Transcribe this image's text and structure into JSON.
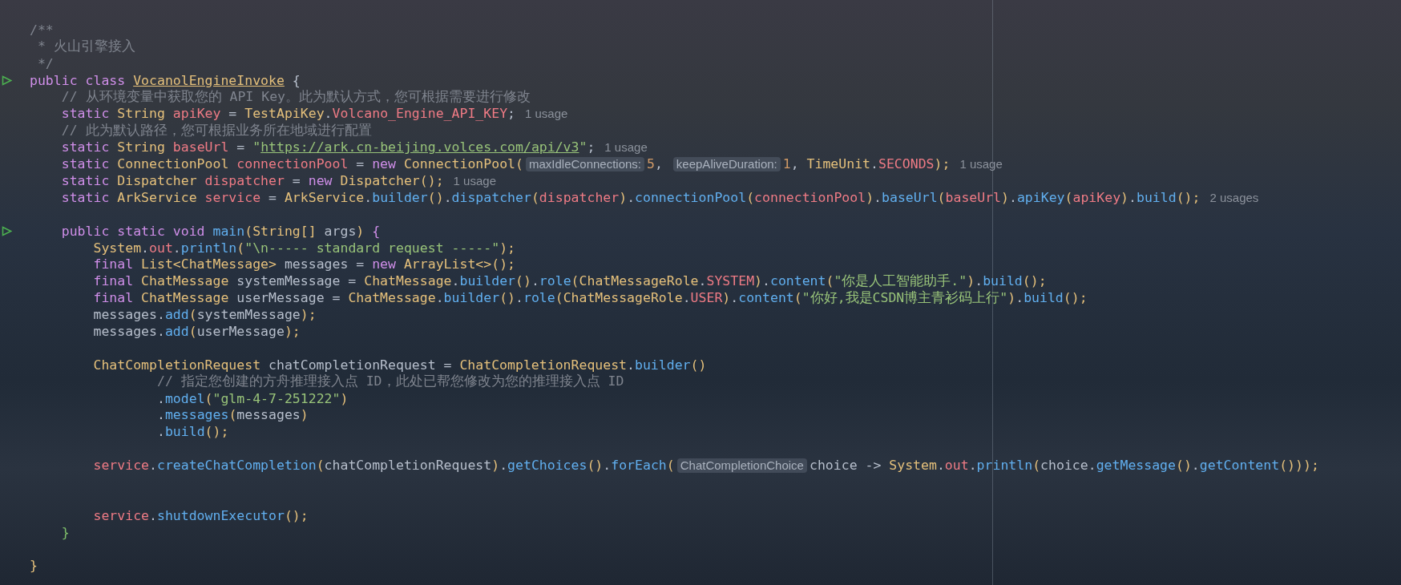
{
  "editor": {
    "lines": [
      {
        "run_marker": false,
        "runs": [
          {
            "kind": "code",
            "tokens": [
              {
                "kind": "comment",
                "text": "/**"
              }
            ]
          }
        ]
      },
      {
        "run_marker": false,
        "runs": [
          {
            "kind": "code",
            "tokens": [
              {
                "kind": "comment",
                "text": " * 火山引擎接入"
              }
            ]
          }
        ]
      },
      {
        "run_marker": false,
        "runs": [
          {
            "kind": "code",
            "tokens": [
              {
                "kind": "comment",
                "text": " */"
              }
            ]
          }
        ]
      },
      {
        "run_marker": true,
        "runs": [
          {
            "kind": "code",
            "tokens": [
              {
                "kind": "keyword",
                "text": "public class "
              },
              {
                "kind": "classname",
                "text": "VocanolEngineInvoke"
              },
              {
                "kind": "plain",
                "text": " {"
              }
            ]
          }
        ]
      },
      {
        "run_marker": false,
        "runs": [
          {
            "kind": "code",
            "tokens": [
              {
                "kind": "comment",
                "text": "    // 从环境变量中获取您的 API Key。此为默认方式，您可根据需要进行修改"
              }
            ]
          }
        ]
      },
      {
        "run_marker": false,
        "runs": [
          {
            "kind": "code",
            "tokens": [
              {
                "kind": "keyword",
                "text": "    static "
              },
              {
                "kind": "type",
                "text": "String "
              },
              {
                "kind": "field",
                "text": "apiKey"
              },
              {
                "kind": "plain",
                "text": " = "
              },
              {
                "kind": "type",
                "text": "TestApiKey"
              },
              {
                "kind": "plain",
                "text": "."
              },
              {
                "kind": "field",
                "text": "Volcano_Engine_API_KEY"
              },
              {
                "kind": "plain",
                "text": ";"
              }
            ]
          },
          {
            "kind": "usage",
            "text": "1 usage"
          }
        ]
      },
      {
        "run_marker": false,
        "runs": [
          {
            "kind": "code",
            "tokens": [
              {
                "kind": "comment",
                "text": "    // 此为默认路径，您可根据业务所在地域进行配置"
              }
            ]
          }
        ]
      },
      {
        "run_marker": false,
        "runs": [
          {
            "kind": "code",
            "tokens": [
              {
                "kind": "keyword",
                "text": "    static "
              },
              {
                "kind": "type",
                "text": "String "
              },
              {
                "kind": "field",
                "text": "baseUrl"
              },
              {
                "kind": "plain",
                "text": " = "
              },
              {
                "kind": "string",
                "text": "\""
              },
              {
                "kind": "link",
                "text": "https://ark.cn-beijing.volces.com/api/v3"
              },
              {
                "kind": "string",
                "text": "\""
              },
              {
                "kind": "plain",
                "text": ";"
              }
            ]
          },
          {
            "kind": "usage",
            "text": "1 usage"
          }
        ]
      },
      {
        "run_marker": false,
        "runs": [
          {
            "kind": "code",
            "tokens": [
              {
                "kind": "keyword",
                "text": "    static "
              },
              {
                "kind": "type",
                "text": "ConnectionPool "
              },
              {
                "kind": "field",
                "text": "connectionPool"
              },
              {
                "kind": "plain",
                "text": " = "
              },
              {
                "kind": "keyword",
                "text": "new "
              },
              {
                "kind": "type",
                "text": "ConnectionPool("
              }
            ]
          },
          {
            "kind": "hint",
            "text": "maxIdleConnections:"
          },
          {
            "kind": "code",
            "tokens": [
              {
                "kind": "number",
                "text": "5"
              },
              {
                "kind": "plain",
                "text": ", "
              }
            ]
          },
          {
            "kind": "hint",
            "text": "keepAliveDuration:"
          },
          {
            "kind": "code",
            "tokens": [
              {
                "kind": "number",
                "text": "1"
              },
              {
                "kind": "plain",
                "text": ", "
              },
              {
                "kind": "type",
                "text": "TimeUnit"
              },
              {
                "kind": "plain",
                "text": "."
              },
              {
                "kind": "field",
                "text": "SECONDS"
              },
              {
                "kind": "type",
                "text": ");"
              }
            ]
          },
          {
            "kind": "usage",
            "text": "1 usage"
          }
        ]
      },
      {
        "run_marker": false,
        "runs": [
          {
            "kind": "code",
            "tokens": [
              {
                "kind": "keyword",
                "text": "    static "
              },
              {
                "kind": "type",
                "text": "Dispatcher "
              },
              {
                "kind": "field",
                "text": "dispatcher"
              },
              {
                "kind": "plain",
                "text": " = "
              },
              {
                "kind": "keyword",
                "text": "new "
              },
              {
                "kind": "type",
                "text": "Dispatcher();"
              }
            ]
          },
          {
            "kind": "usage",
            "text": "1 usage"
          }
        ]
      },
      {
        "run_marker": false,
        "runs": [
          {
            "kind": "code",
            "tokens": [
              {
                "kind": "keyword",
                "text": "    static "
              },
              {
                "kind": "type",
                "text": "ArkService "
              },
              {
                "kind": "field",
                "text": "service"
              },
              {
                "kind": "plain",
                "text": " = "
              },
              {
                "kind": "type",
                "text": "ArkService"
              },
              {
                "kind": "plain",
                "text": "."
              },
              {
                "kind": "method",
                "text": "builder"
              },
              {
                "kind": "type",
                "text": "()"
              },
              {
                "kind": "plain",
                "text": "."
              },
              {
                "kind": "method",
                "text": "dispatcher"
              },
              {
                "kind": "type",
                "text": "("
              },
              {
                "kind": "field",
                "text": "dispatcher"
              },
              {
                "kind": "type",
                "text": ")"
              },
              {
                "kind": "plain",
                "text": "."
              },
              {
                "kind": "method",
                "text": "connectionPool"
              },
              {
                "kind": "type",
                "text": "("
              },
              {
                "kind": "field",
                "text": "connectionPool"
              },
              {
                "kind": "type",
                "text": ")"
              },
              {
                "kind": "plain",
                "text": "."
              },
              {
                "kind": "method",
                "text": "baseUrl"
              },
              {
                "kind": "type",
                "text": "("
              },
              {
                "kind": "field",
                "text": "baseUrl"
              },
              {
                "kind": "type",
                "text": ")"
              },
              {
                "kind": "plain",
                "text": "."
              },
              {
                "kind": "method",
                "text": "apiKey"
              },
              {
                "kind": "type",
                "text": "("
              },
              {
                "kind": "field",
                "text": "apiKey"
              },
              {
                "kind": "type",
                "text": ")"
              },
              {
                "kind": "plain",
                "text": "."
              },
              {
                "kind": "method",
                "text": "build"
              },
              {
                "kind": "type",
                "text": "();"
              }
            ]
          },
          {
            "kind": "usage",
            "text": "2 usages"
          }
        ]
      },
      {
        "run_marker": false
      },
      {
        "run_marker": true,
        "runs": [
          {
            "kind": "code",
            "tokens": [
              {
                "kind": "keyword",
                "text": "    public static void "
              },
              {
                "kind": "method",
                "text": "main"
              },
              {
                "kind": "type",
                "text": "(String[] "
              },
              {
                "kind": "plain",
                "text": "args"
              },
              {
                "kind": "type",
                "text": ") "
              },
              {
                "kind": "keyword",
                "text": "{"
              }
            ]
          }
        ]
      },
      {
        "run_marker": false,
        "runs": [
          {
            "kind": "code",
            "tokens": [
              {
                "kind": "type",
                "text": "        System"
              },
              {
                "kind": "plain",
                "text": "."
              },
              {
                "kind": "field",
                "text": "out"
              },
              {
                "kind": "plain",
                "text": "."
              },
              {
                "kind": "method",
                "text": "println"
              },
              {
                "kind": "type",
                "text": "("
              },
              {
                "kind": "string",
                "text": "\"\\n----- standard request -----\""
              },
              {
                "kind": "type",
                "text": ");"
              }
            ]
          }
        ]
      },
      {
        "run_marker": false,
        "runs": [
          {
            "kind": "code",
            "tokens": [
              {
                "kind": "keyword",
                "text": "        final "
              },
              {
                "kind": "type",
                "text": "List<ChatMessage> "
              },
              {
                "kind": "plain",
                "text": "messages = "
              },
              {
                "kind": "keyword",
                "text": "new "
              },
              {
                "kind": "type",
                "text": "ArrayList<>();"
              }
            ]
          }
        ]
      },
      {
        "run_marker": false,
        "runs": [
          {
            "kind": "code",
            "tokens": [
              {
                "kind": "keyword",
                "text": "        final "
              },
              {
                "kind": "type",
                "text": "ChatMessage "
              },
              {
                "kind": "plain",
                "text": "systemMessage = "
              },
              {
                "kind": "type",
                "text": "ChatMessage"
              },
              {
                "kind": "plain",
                "text": "."
              },
              {
                "kind": "method",
                "text": "builder"
              },
              {
                "kind": "type",
                "text": "()"
              },
              {
                "kind": "plain",
                "text": "."
              },
              {
                "kind": "method",
                "text": "role"
              },
              {
                "kind": "type",
                "text": "(ChatMessageRole"
              },
              {
                "kind": "plain",
                "text": "."
              },
              {
                "kind": "field",
                "text": "SYSTEM"
              },
              {
                "kind": "type",
                "text": ")"
              },
              {
                "kind": "plain",
                "text": "."
              },
              {
                "kind": "method",
                "text": "content"
              },
              {
                "kind": "type",
                "text": "("
              },
              {
                "kind": "string",
                "text": "\"你是人工智能助手.\""
              },
              {
                "kind": "type",
                "text": ")"
              },
              {
                "kind": "plain",
                "text": "."
              },
              {
                "kind": "method",
                "text": "build"
              },
              {
                "kind": "type",
                "text": "();"
              }
            ]
          }
        ]
      },
      {
        "run_marker": false,
        "runs": [
          {
            "kind": "code",
            "tokens": [
              {
                "kind": "keyword",
                "text": "        final "
              },
              {
                "kind": "type",
                "text": "ChatMessage "
              },
              {
                "kind": "plain",
                "text": "userMessage = "
              },
              {
                "kind": "type",
                "text": "ChatMessage"
              },
              {
                "kind": "plain",
                "text": "."
              },
              {
                "kind": "method",
                "text": "builder"
              },
              {
                "kind": "type",
                "text": "()"
              },
              {
                "kind": "plain",
                "text": "."
              },
              {
                "kind": "method",
                "text": "role"
              },
              {
                "kind": "type",
                "text": "(ChatMessageRole"
              },
              {
                "kind": "plain",
                "text": "."
              },
              {
                "kind": "field",
                "text": "USER"
              },
              {
                "kind": "type",
                "text": ")"
              },
              {
                "kind": "plain",
                "text": "."
              },
              {
                "kind": "method",
                "text": "content"
              },
              {
                "kind": "type",
                "text": "("
              },
              {
                "kind": "string",
                "text": "\"你好,我是CSDN博主青衫码上行\""
              },
              {
                "kind": "type",
                "text": ")"
              },
              {
                "kind": "plain",
                "text": "."
              },
              {
                "kind": "method",
                "text": "build"
              },
              {
                "kind": "type",
                "text": "();"
              }
            ]
          }
        ]
      },
      {
        "run_marker": false,
        "runs": [
          {
            "kind": "code",
            "tokens": [
              {
                "kind": "plain",
                "text": "        messages."
              },
              {
                "kind": "method",
                "text": "add"
              },
              {
                "kind": "type",
                "text": "("
              },
              {
                "kind": "plain",
                "text": "systemMessage"
              },
              {
                "kind": "type",
                "text": ");"
              }
            ]
          }
        ]
      },
      {
        "run_marker": false,
        "runs": [
          {
            "kind": "code",
            "tokens": [
              {
                "kind": "plain",
                "text": "        messages."
              },
              {
                "kind": "method",
                "text": "add"
              },
              {
                "kind": "type",
                "text": "("
              },
              {
                "kind": "plain",
                "text": "userMessage"
              },
              {
                "kind": "type",
                "text": ");"
              }
            ]
          }
        ]
      },
      {
        "run_marker": false
      },
      {
        "run_marker": false,
        "runs": [
          {
            "kind": "code",
            "tokens": [
              {
                "kind": "type",
                "text": "        ChatCompletionRequest "
              },
              {
                "kind": "plain",
                "text": "chatCompletionRequest = "
              },
              {
                "kind": "type",
                "text": "ChatCompletionRequest"
              },
              {
                "kind": "plain",
                "text": "."
              },
              {
                "kind": "method",
                "text": "builder"
              },
              {
                "kind": "type",
                "text": "()"
              }
            ]
          }
        ]
      },
      {
        "run_marker": false,
        "runs": [
          {
            "kind": "code",
            "tokens": [
              {
                "kind": "comment",
                "text": "                // 指定您创建的方舟推理接入点 ID，此处已帮您修改为您的推理接入点 ID"
              }
            ]
          }
        ]
      },
      {
        "run_marker": false,
        "runs": [
          {
            "kind": "code",
            "tokens": [
              {
                "kind": "plain",
                "text": "                ."
              },
              {
                "kind": "method",
                "text": "model"
              },
              {
                "kind": "type",
                "text": "("
              },
              {
                "kind": "string",
                "text": "\"glm-4-7-251222\""
              },
              {
                "kind": "type",
                "text": ")"
              }
            ]
          }
        ]
      },
      {
        "run_marker": false,
        "runs": [
          {
            "kind": "code",
            "tokens": [
              {
                "kind": "plain",
                "text": "                ."
              },
              {
                "kind": "method",
                "text": "messages"
              },
              {
                "kind": "type",
                "text": "("
              },
              {
                "kind": "plain",
                "text": "messages"
              },
              {
                "kind": "type",
                "text": ")"
              }
            ]
          }
        ]
      },
      {
        "run_marker": false,
        "runs": [
          {
            "kind": "code",
            "tokens": [
              {
                "kind": "plain",
                "text": "                ."
              },
              {
                "kind": "method",
                "text": "build"
              },
              {
                "kind": "type",
                "text": "();"
              }
            ]
          }
        ]
      },
      {
        "run_marker": false
      },
      {
        "run_marker": false,
        "runs": [
          {
            "kind": "code",
            "tokens": [
              {
                "kind": "field",
                "text": "        service"
              },
              {
                "kind": "plain",
                "text": "."
              },
              {
                "kind": "method",
                "text": "createChatCompletion"
              },
              {
                "kind": "type",
                "text": "("
              },
              {
                "kind": "plain",
                "text": "chatCompletionRequest"
              },
              {
                "kind": "type",
                "text": ")"
              },
              {
                "kind": "plain",
                "text": "."
              },
              {
                "kind": "method",
                "text": "getChoices"
              },
              {
                "kind": "type",
                "text": "()"
              },
              {
                "kind": "plain",
                "text": "."
              },
              {
                "kind": "method",
                "text": "forEach"
              },
              {
                "kind": "type",
                "text": "("
              }
            ]
          },
          {
            "kind": "hint",
            "text": "ChatCompletionChoice"
          },
          {
            "kind": "code",
            "tokens": [
              {
                "kind": "plain",
                "text": "choice -> "
              },
              {
                "kind": "type",
                "text": "System"
              },
              {
                "kind": "plain",
                "text": "."
              },
              {
                "kind": "field",
                "text": "out"
              },
              {
                "kind": "plain",
                "text": "."
              },
              {
                "kind": "method",
                "text": "println"
              },
              {
                "kind": "type",
                "text": "("
              },
              {
                "kind": "plain",
                "text": "choice."
              },
              {
                "kind": "method",
                "text": "getMessage"
              },
              {
                "kind": "type",
                "text": "()"
              },
              {
                "kind": "plain",
                "text": "."
              },
              {
                "kind": "method",
                "text": "getContent"
              },
              {
                "kind": "type",
                "text": "()));"
              }
            ]
          }
        ]
      },
      {
        "run_marker": false
      },
      {
        "run_marker": false
      },
      {
        "run_marker": false,
        "runs": [
          {
            "kind": "code",
            "tokens": [
              {
                "kind": "field",
                "text": "        service"
              },
              {
                "kind": "plain",
                "text": "."
              },
              {
                "kind": "method",
                "text": "shutdownExecutor"
              },
              {
                "kind": "type",
                "text": "();"
              }
            ]
          }
        ]
      },
      {
        "run_marker": false,
        "runs": [
          {
            "kind": "code",
            "tokens": [
              {
                "kind": "brace",
                "text": "    }"
              }
            ]
          }
        ]
      },
      {
        "run_marker": false
      },
      {
        "run_marker": false,
        "runs": [
          {
            "kind": "code",
            "tokens": [
              {
                "kind": "type",
                "text": "}"
              }
            ]
          }
        ]
      }
    ]
  }
}
